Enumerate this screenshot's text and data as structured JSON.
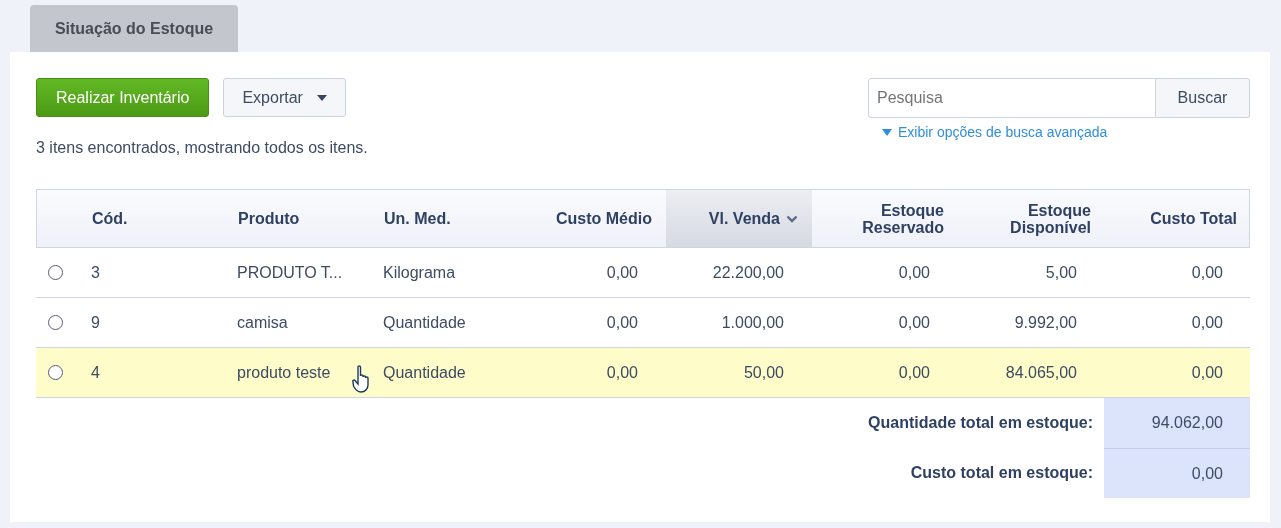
{
  "tabs": [
    {
      "label": "Situação do Estoque",
      "selected": true
    }
  ],
  "toolbar": {
    "primary_button": "Realizar Inventário",
    "export_button": "Exportar"
  },
  "search": {
    "placeholder": "Pesquisa",
    "button": "Buscar",
    "advanced_link": "Exibir opções de busca avançada"
  },
  "result_count": "3 itens encontrados, mostrando todos os itens.",
  "table": {
    "columns": [
      {
        "label": "Cód.",
        "sorted": false
      },
      {
        "label": "Produto",
        "sorted": false
      },
      {
        "label": "Un. Med.",
        "sorted": false
      },
      {
        "label": "Custo Médio",
        "sorted": false
      },
      {
        "label": "Vl. Venda",
        "sorted": true
      },
      {
        "label": "Estoque Reservado",
        "sorted": false
      },
      {
        "label": "Estoque Disponível",
        "sorted": false
      },
      {
        "label": "Custo Total",
        "sorted": false
      }
    ],
    "rows": [
      {
        "selected": false,
        "highlighted": false,
        "cells": [
          "3",
          "PRODUTO T...",
          "Kilograma",
          "0,00",
          "22.200,00",
          "0,00",
          "5,00",
          "0,00"
        ]
      },
      {
        "selected": false,
        "highlighted": false,
        "cells": [
          "9",
          "camisa",
          "Quantidade",
          "0,00",
          "1.000,00",
          "0,00",
          "9.992,00",
          "0,00"
        ]
      },
      {
        "selected": false,
        "highlighted": true,
        "cells": [
          "4",
          "produto teste",
          "Quantidade",
          "0,00",
          "50,00",
          "0,00",
          "84.065,00",
          "0,00"
        ]
      }
    ]
  },
  "totals": [
    {
      "label": "Quantidade total em estoque:",
      "value": "94.062,00"
    },
    {
      "label": "Custo total em estoque:",
      "value": "0,00"
    }
  ]
}
